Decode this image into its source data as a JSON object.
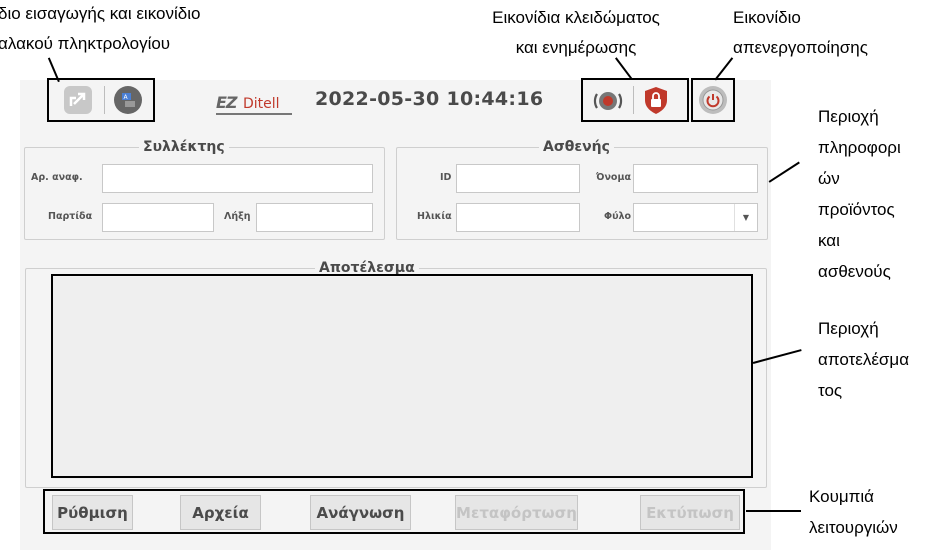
{
  "annotations": {
    "input_icons_line1": "διο εισαγωγής και εικονίδιο",
    "input_icons_line2": "αλακού πληκτρολογίου",
    "lock_icons_line1": "Εικονίδια κλειδώματος",
    "lock_icons_line2": "και ενημέρωσης",
    "power_line1": "Εικονίδιο",
    "power_line2": "απενεργοποίησης",
    "info_area": [
      "Περιοχή",
      "πληροφορι",
      "ών",
      "προϊόντος",
      "και",
      "ασθενούς"
    ],
    "result_area": [
      "Περιοχή",
      "αποτελέσμα",
      "τος"
    ],
    "function_buttons": [
      "Κουμπιά",
      "λειτουργιών"
    ]
  },
  "header": {
    "logo_prefix": "EZ",
    "logo_suffix": "Ditell",
    "datetime": "2022-05-30 10:44:16"
  },
  "collector": {
    "title": "Συλλέκτης",
    "ref_label": "Αρ. αναφ.",
    "batch_label": "Παρτίδα",
    "expiry_label": "Λήξη",
    "ref_value": "",
    "batch_value": "",
    "expiry_value": ""
  },
  "patient": {
    "title": "Ασθενής",
    "id_label": "ID",
    "name_label": "Όνομα",
    "age_label": "Ηλικία",
    "gender_label": "Φύλο",
    "id_value": "",
    "name_value": "",
    "age_value": "",
    "gender_value": ""
  },
  "result": {
    "title": "Αποτέλεσμα"
  },
  "buttons": {
    "settings": "Ρύθμιση",
    "files": "Αρχεία",
    "read": "Ανάγνωση",
    "upload": "Μεταφόρτωση",
    "print": "Εκτύπωση"
  },
  "colors": {
    "app_background": "#f4f4f4",
    "disabled_text": "#c4c4c4",
    "logo_red": "#c0392b"
  }
}
